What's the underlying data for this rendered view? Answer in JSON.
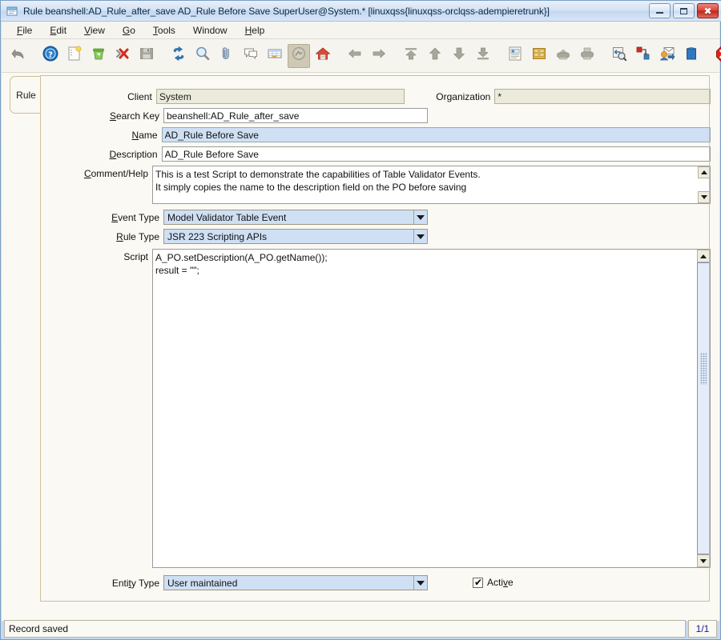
{
  "window": {
    "title": "Rule  beanshell:AD_Rule_after_save  AD_Rule Before Save  SuperUser@System.* [linuxqss{linuxqss-orclqss-adempieretrunk}]",
    "icon": "window-document-icon",
    "minimize_label": "Minimize",
    "maximize_label": "Maximize",
    "close_label": "Close"
  },
  "menubar": {
    "items": [
      {
        "label": "File",
        "mnemonic": "F"
      },
      {
        "label": "Edit",
        "mnemonic": "E"
      },
      {
        "label": "View",
        "mnemonic": "V"
      },
      {
        "label": "Go",
        "mnemonic": "G"
      },
      {
        "label": "Tools",
        "mnemonic": "T"
      },
      {
        "label": "Window",
        "mnemonic": ""
      },
      {
        "label": "Help",
        "mnemonic": "H"
      }
    ]
  },
  "toolbar": {
    "buttons": [
      {
        "name": "undo-icon",
        "tooltip": "Undo"
      },
      {
        "name": "help-icon",
        "tooltip": "Help"
      },
      {
        "name": "new-record-icon",
        "tooltip": "New Record"
      },
      {
        "name": "delete-icon",
        "tooltip": "Delete"
      },
      {
        "name": "delete-selection-icon",
        "tooltip": "Delete Selection"
      },
      {
        "name": "save-icon",
        "tooltip": "Save Changes"
      },
      {
        "name": "refresh-icon",
        "tooltip": "Refresh"
      },
      {
        "name": "find-icon",
        "tooltip": "Find Record"
      },
      {
        "name": "attachment-icon",
        "tooltip": "Attachment"
      },
      {
        "name": "chat-icon",
        "tooltip": "Chat / Notes"
      },
      {
        "name": "grid-toggle-icon",
        "tooltip": "Toggle Grid View"
      },
      {
        "name": "history-icon",
        "tooltip": "History Records",
        "pressed": true
      },
      {
        "name": "home-icon",
        "tooltip": "Home"
      },
      {
        "name": "previous-icon",
        "tooltip": "Previous Record"
      },
      {
        "name": "next-icon",
        "tooltip": "Next Record"
      },
      {
        "name": "first-record-icon",
        "tooltip": "First Record"
      },
      {
        "name": "prev-page-icon",
        "tooltip": "Previous Page"
      },
      {
        "name": "next-page-icon",
        "tooltip": "Next Page"
      },
      {
        "name": "last-record-icon",
        "tooltip": "Last Record"
      },
      {
        "name": "report-icon",
        "tooltip": "Report"
      },
      {
        "name": "archive-icon",
        "tooltip": "Archived Documents"
      },
      {
        "name": "print-preview-icon",
        "tooltip": "Print Preview"
      },
      {
        "name": "print-icon",
        "tooltip": "Print"
      },
      {
        "name": "zoom-across-icon",
        "tooltip": "Zoom Across"
      },
      {
        "name": "active-workflow-icon",
        "tooltip": "Active Workflow"
      },
      {
        "name": "requests-icon",
        "tooltip": "Requests"
      },
      {
        "name": "product-info-icon",
        "tooltip": "Product Info"
      },
      {
        "name": "exit-icon",
        "tooltip": "Exit"
      }
    ]
  },
  "tabs": {
    "items": [
      {
        "label": "Rule",
        "selected": true
      }
    ]
  },
  "form": {
    "client": {
      "label": "Client",
      "value": "System",
      "state": "readonly"
    },
    "organization": {
      "label": "Organization",
      "value": "*",
      "state": "readonly"
    },
    "search_key": {
      "label": "Search Key",
      "mnemonic": "S",
      "value": "beanshell:AD_Rule_after_save",
      "state": "plain"
    },
    "name": {
      "label": "Name",
      "mnemonic": "N",
      "value": "AD_Rule Before Save",
      "state": "mandatory"
    },
    "description": {
      "label": "Description",
      "mnemonic": "D",
      "value": "AD_Rule Before Save",
      "state": "plain"
    },
    "comment_help": {
      "label": "Comment/Help",
      "mnemonic": "C",
      "value": "This is a test Script to demonstrate the capabilities of Table Validator Events.\nIt simply copies the name to the description field on the PO before saving"
    },
    "event_type": {
      "label": "Event Type",
      "mnemonic": "E",
      "value": "Model Validator Table Event"
    },
    "rule_type": {
      "label": "Rule Type",
      "mnemonic": "R",
      "value": "JSR 223 Scripting APIs"
    },
    "script": {
      "label": "Script",
      "value": "A_PO.setDescription(A_PO.getName());\nresult = \"\";"
    },
    "entity_type": {
      "label": "Entity Type",
      "mnemonic": "t",
      "value": "User maintained"
    },
    "active": {
      "label": "Active",
      "mnemonic": "v",
      "checked": true,
      "checkmark": "✔"
    }
  },
  "statusbar": {
    "message": "Record saved",
    "record_count": "1/1"
  },
  "colors": {
    "mandatory_field": "#cfe0f4",
    "readonly_field": "#eceadb",
    "panel_background": "#fbf9f3",
    "panel_border": "#cdbf9b",
    "title_gradient_top": "#e8f0fa",
    "status_count_text": "#1414a0"
  }
}
